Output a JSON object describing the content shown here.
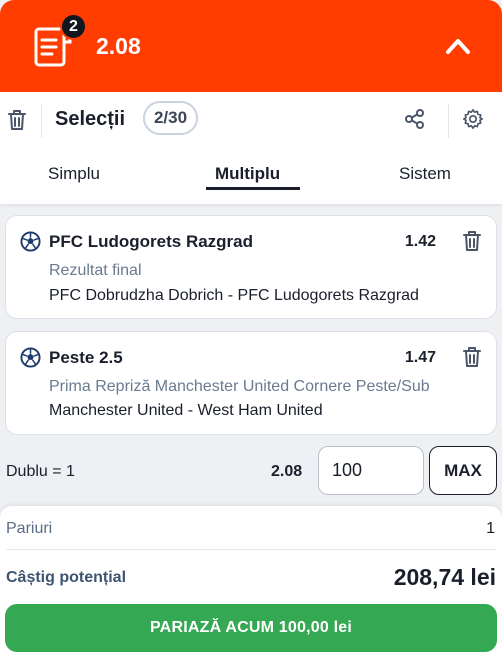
{
  "header": {
    "badge_count": "2",
    "total_odds": "2.08",
    "accent_color": "#ff3d00"
  },
  "toolbar": {
    "title": "Selecții",
    "selection_count": "2/30"
  },
  "tabs": [
    {
      "label": "Simplu",
      "active": false
    },
    {
      "label": "Multiplu",
      "active": true
    },
    {
      "label": "Sistem",
      "active": false
    }
  ],
  "selections": [
    {
      "name": "PFC Ludogorets Razgrad",
      "odds": "1.42",
      "market": "Rezultat final",
      "event": "PFC Dobrudzha Dobrich - PFC Ludogorets Razgrad",
      "icon": "football-icon"
    },
    {
      "name": "Peste 2.5",
      "odds": "1.47",
      "market": "Prima Repriză Manchester United Cornere Peste/Sub",
      "event": "Manchester United - West Ham United",
      "icon": "football-icon"
    }
  ],
  "stake": {
    "bet_type": "Dublu = 1",
    "odds": "2.08",
    "amount": "100",
    "max_label": "MAX"
  },
  "summary": {
    "bets_label": "Pariuri",
    "bets_value": "1",
    "potential_win_label": "Câștig potențial",
    "potential_win_value": "208,74 lei",
    "place_bet_label": "PARIAZĂ ACUM 100,00 lei",
    "place_bet_color": "#34a853"
  }
}
